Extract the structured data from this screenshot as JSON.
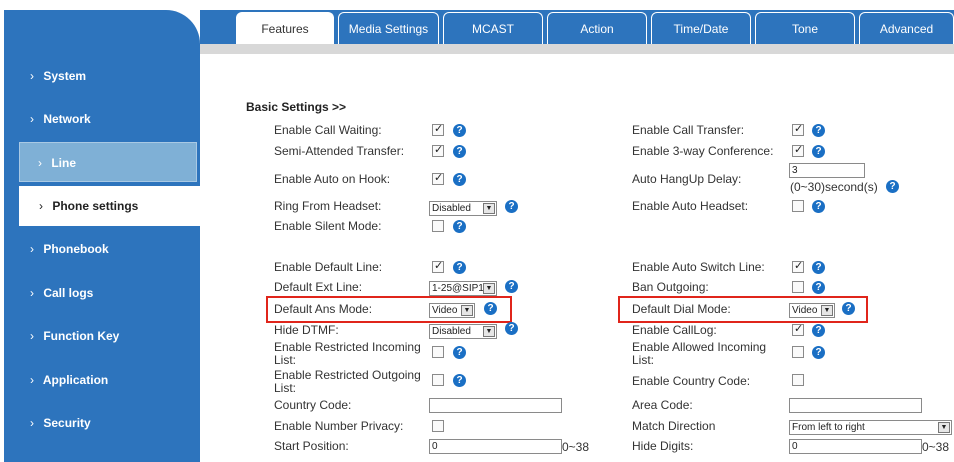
{
  "sidebar": {
    "items": [
      {
        "label": "System"
      },
      {
        "label": "Network"
      },
      {
        "label": "Line"
      },
      {
        "label": "Phone settings"
      },
      {
        "label": "Phonebook"
      },
      {
        "label": "Call logs"
      },
      {
        "label": "Function Key"
      },
      {
        "label": "Application"
      },
      {
        "label": "Security"
      }
    ]
  },
  "tabs": [
    "Features",
    "Media Settings",
    "MCAST",
    "Action",
    "Time/Date",
    "Tone",
    "Advanced"
  ],
  "section_title": "Basic Settings >>",
  "fields": {
    "call_waiting": "Enable Call Waiting:",
    "call_transfer": "Enable Call Transfer:",
    "semi_transfer": "Semi-Attended Transfer:",
    "three_way": "Enable 3-way Conference:",
    "auto_on_hook": "Enable Auto on Hook:",
    "auto_hangup_delay": "Auto HangUp Delay:",
    "auto_hangup_value": "3",
    "auto_hangup_unit": "(0~30)second(s)",
    "ring_from_headset": "Ring From Headset:",
    "ring_from_headset_value": "Disabled",
    "auto_headset": "Enable Auto Headset:",
    "silent_mode": "Enable Silent Mode:",
    "default_line": "Enable Default Line:",
    "auto_switch_line": "Enable Auto Switch Line:",
    "default_ext_line": "Default Ext Line:",
    "default_ext_line_value": "1-25@SIP1",
    "ban_outgoing": "Ban Outgoing:",
    "default_ans_mode": "Default Ans Mode:",
    "default_ans_mode_value": "Video",
    "default_dial_mode": "Default Dial Mode:",
    "default_dial_mode_value": "Video",
    "hide_dtmf": "Hide DTMF:",
    "hide_dtmf_value": "Disabled",
    "calllog": "Enable CallLog:",
    "restricted_incoming": "Enable Restricted Incoming List:",
    "allowed_incoming": "Enable Allowed Incoming List:",
    "restricted_outgoing": "Enable Restricted Outgoing List:",
    "country_code_enable": "Enable Country Code:",
    "country_code": "Country Code:",
    "area_code": "Area Code:",
    "number_privacy": "Enable Number Privacy:",
    "match_direction": "Match Direction",
    "match_direction_value": "From left to right",
    "start_position": "Start Position:",
    "start_position_value": "0",
    "start_position_range": "0~38",
    "hide_digits": "Hide Digits:",
    "hide_digits_value": "0",
    "hide_digits_range": "0~38"
  },
  "help_glyph": "?",
  "check_states": {
    "call_waiting": true,
    "call_transfer": true,
    "semi_transfer": true,
    "three_way": true,
    "auto_on_hook": true,
    "auto_headset": false,
    "silent_mode": false,
    "default_line": true,
    "auto_switch_line": true,
    "ban_outgoing": false,
    "calllog": true,
    "restricted_incoming": false,
    "allowed_incoming": false,
    "restricted_outgoing": false,
    "country_code_enable": false,
    "number_privacy": false
  },
  "colors": {
    "brand_blue": "#2d74bd",
    "highlight_red": "#e0251b",
    "help_blue": "#1a6fc4"
  }
}
